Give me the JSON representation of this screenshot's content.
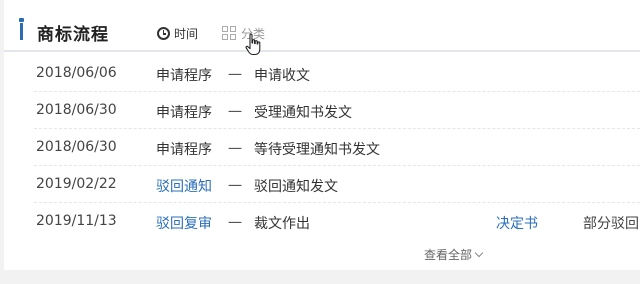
{
  "header": {
    "title": "商标流程",
    "tabs": [
      {
        "label": "时间",
        "icon": "clock-icon",
        "active": true
      },
      {
        "label": "分类",
        "icon": "grid-icon",
        "active": false
      }
    ]
  },
  "rows": [
    {
      "date": "2018/06/06",
      "stage": "申请程序",
      "dash": "一",
      "desc": "申请收文",
      "doc": "",
      "result": ""
    },
    {
      "date": "2018/06/30",
      "stage": "申请程序",
      "dash": "一",
      "desc": "受理通知书发文",
      "doc": "",
      "result": ""
    },
    {
      "date": "2018/06/30",
      "stage": "申请程序",
      "dash": "一",
      "desc": "等待受理通知书发文",
      "doc": "",
      "result": ""
    },
    {
      "date": "2019/02/22",
      "stage": "驳回通知",
      "dash": "一",
      "desc": "驳回通知发文",
      "doc": "",
      "result": ""
    },
    {
      "date": "2019/11/13",
      "stage": "驳回复审",
      "dash": "一",
      "desc": "裁文作出",
      "doc": "决定书",
      "result": "部分驳回"
    }
  ],
  "footer": {
    "view_all": "查看全部"
  },
  "colors": {
    "accent": "#2a6fbc",
    "text": "#333333",
    "muted": "#999999"
  }
}
